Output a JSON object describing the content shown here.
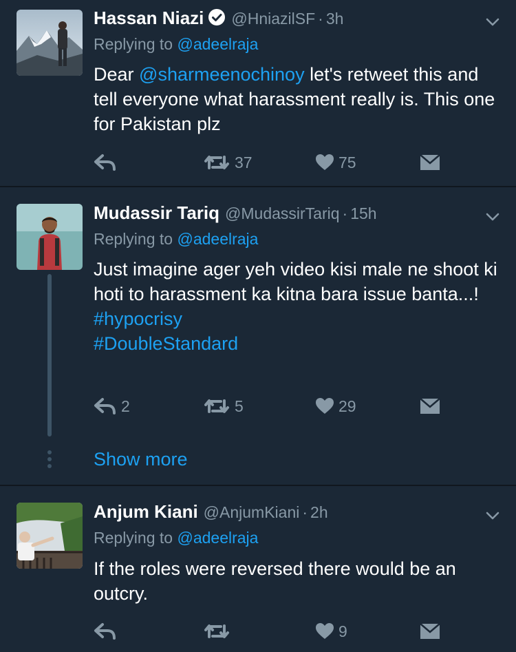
{
  "tweets": [
    {
      "name": "Hassan Niazi",
      "handle": "@HniazilSF",
      "separator": "·",
      "time": "3h",
      "replying_prefix": "Replying to",
      "replying_to": "@adeelraja",
      "text_before": "Dear ",
      "text_mention": "@sharmeenochinoy",
      "text_after": " let's retweet this and tell everyone what harassment really is. This one for Pakistan plz",
      "reply_count": "",
      "retweet_count": "37",
      "like_count": "75",
      "verified": true
    },
    {
      "name": "Mudassir Tariq",
      "handle": "@MudassirTariq",
      "separator": "·",
      "time": "15h",
      "replying_prefix": "Replying to",
      "replying_to": "@adeelraja",
      "text": "Just imagine ager yeh video kisi male ne shoot ki hoti to harassment ka kitna bara issue banta...!",
      "hashtag_1": "#hypocrisy",
      "hashtag_2": "#DoubleStandard",
      "reply_count": "2",
      "retweet_count": "5",
      "like_count": "29"
    },
    {
      "name": "Anjum Kiani",
      "handle": "@AnjumKiani",
      "separator": "·",
      "time": "2h",
      "replying_prefix": "Replying to",
      "replying_to": "@adeelraja",
      "text": "If the roles were reversed there would be an outcry.",
      "reply_count": "",
      "retweet_count": "",
      "like_count": "9"
    }
  ],
  "show_more_label": "Show more",
  "colors": {
    "background": "#1b2836",
    "divider": "#10171e",
    "link": "#1da1f2",
    "muted": "#8899a6",
    "text": "#ffffff"
  },
  "icons": [
    "verified-badge-icon",
    "chevron-down-icon",
    "reply-icon",
    "retweet-icon",
    "heart-icon",
    "direct-message-icon"
  ]
}
